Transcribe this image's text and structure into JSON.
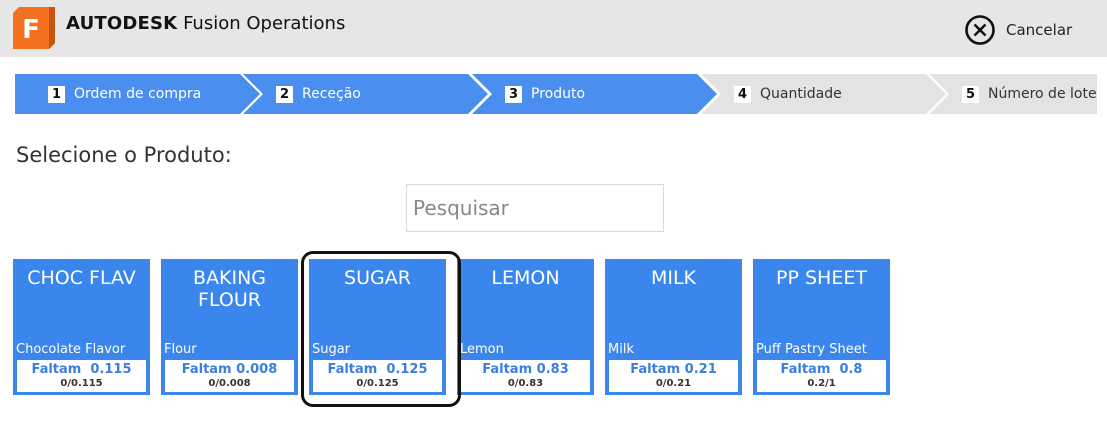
{
  "header": {
    "app_letter": "F",
    "brand_bold": "AUTODESK",
    "brand_rest": "Fusion Operations",
    "cancel_label": "Cancelar",
    "logo_color": "#f37021",
    "close_icon": "close-circle-icon"
  },
  "steps": [
    {
      "number": "1",
      "label": "Ordem de compra",
      "state": "done"
    },
    {
      "number": "2",
      "label": "Receção",
      "state": "done"
    },
    {
      "number": "3",
      "label": "Produto",
      "state": "current"
    },
    {
      "number": "4",
      "label": "Quantidade",
      "state": "pending"
    },
    {
      "number": "5",
      "label": "Número de lote",
      "state": "pending"
    }
  ],
  "colors": {
    "step_active": "#4a8ff0",
    "step_inactive": "#e3e3e3",
    "card_bg": "#3a86ec",
    "missing_text": "#3a7ee0"
  },
  "page_title": "Selecione o Produto:",
  "search": {
    "placeholder": "Pesquisar",
    "value": ""
  },
  "products": [
    {
      "code": "CHOC FLAV",
      "description": "Chocolate Flavor",
      "missing_label": "Faltam",
      "missing_value": "0.115",
      "ratio": "0/0.115",
      "selected": false
    },
    {
      "code": "BAKING FLOUR",
      "description": "Flour",
      "missing_label": "Faltam",
      "missing_value": "0.008",
      "ratio": "0/0.008",
      "selected": false
    },
    {
      "code": "SUGAR",
      "description": "Sugar",
      "missing_label": "Faltam",
      "missing_value": "0.125",
      "ratio": "0/0.125",
      "selected": true
    },
    {
      "code": "LEMON",
      "description": "Lemon",
      "missing_label": "Faltam",
      "missing_value": "0.83",
      "ratio": "0/0.83",
      "selected": false
    },
    {
      "code": "MILK",
      "description": "Milk",
      "missing_label": "Faltam",
      "missing_value": "0.21",
      "ratio": "0/0.21",
      "selected": false
    },
    {
      "code": "PP SHEET",
      "description": "Puff Pastry Sheet",
      "missing_label": "Faltam",
      "missing_value": "0.8",
      "ratio": "0.2/1",
      "selected": false
    }
  ]
}
